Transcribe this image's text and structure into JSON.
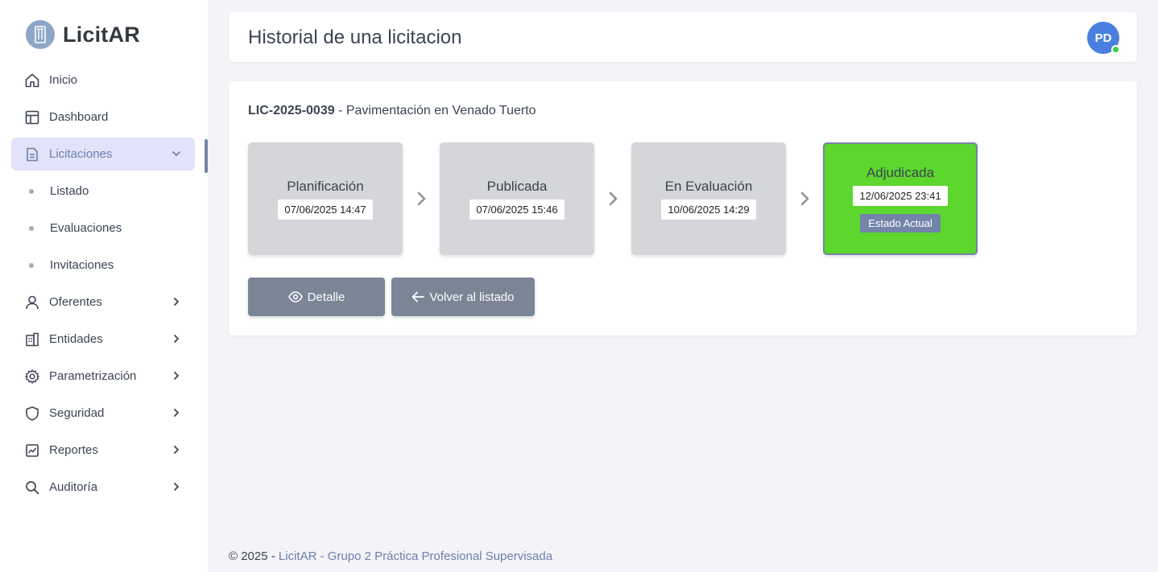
{
  "brand": {
    "name": "LicitAR"
  },
  "sidebar": {
    "items": [
      {
        "label": "Inicio",
        "icon": "home-icon"
      },
      {
        "label": "Dashboard",
        "icon": "dashboard-icon"
      },
      {
        "label": "Licitaciones",
        "icon": "document-icon",
        "active": true,
        "expanded": true
      },
      {
        "label": "Oferentes",
        "icon": "user-icon"
      },
      {
        "label": "Entidades",
        "icon": "building-icon"
      },
      {
        "label": "Parametrización",
        "icon": "gear-icon"
      },
      {
        "label": "Seguridad",
        "icon": "shield-icon"
      },
      {
        "label": "Reportes",
        "icon": "chart-icon"
      },
      {
        "label": "Auditoría",
        "icon": "search-icon"
      }
    ],
    "subitems": [
      {
        "label": "Listado"
      },
      {
        "label": "Evaluaciones"
      },
      {
        "label": "Invitaciones"
      }
    ]
  },
  "header": {
    "title": "Historial de una licitacion",
    "avatar_initials": "PD",
    "avatar_color": "#4a7fe0",
    "online_color": "#3bd141"
  },
  "licitacion": {
    "code": "LIC-2025-0039",
    "separator": " - ",
    "name": "Pavimentación en Venado Tuerto"
  },
  "steps": [
    {
      "name": "Planificación",
      "date": "07/06/2025 14:47"
    },
    {
      "name": "Publicada",
      "date": "07/06/2025 15:46"
    },
    {
      "name": "En Evaluación",
      "date": "10/06/2025 14:29"
    },
    {
      "name": "Adjudicada",
      "date": "12/06/2025 23:41",
      "current": true,
      "badge": "Estado Actual"
    }
  ],
  "colors": {
    "current_step": "#5dd62d",
    "step": "#d4d6da",
    "accent": "#7384a8"
  },
  "buttons": {
    "detail": "Detalle",
    "back": "Volver al listado"
  },
  "footer": {
    "prefix": "© 2025 - ",
    "brand": "LicitAR - Grupo 2 Práctica Profesional Supervisada"
  }
}
